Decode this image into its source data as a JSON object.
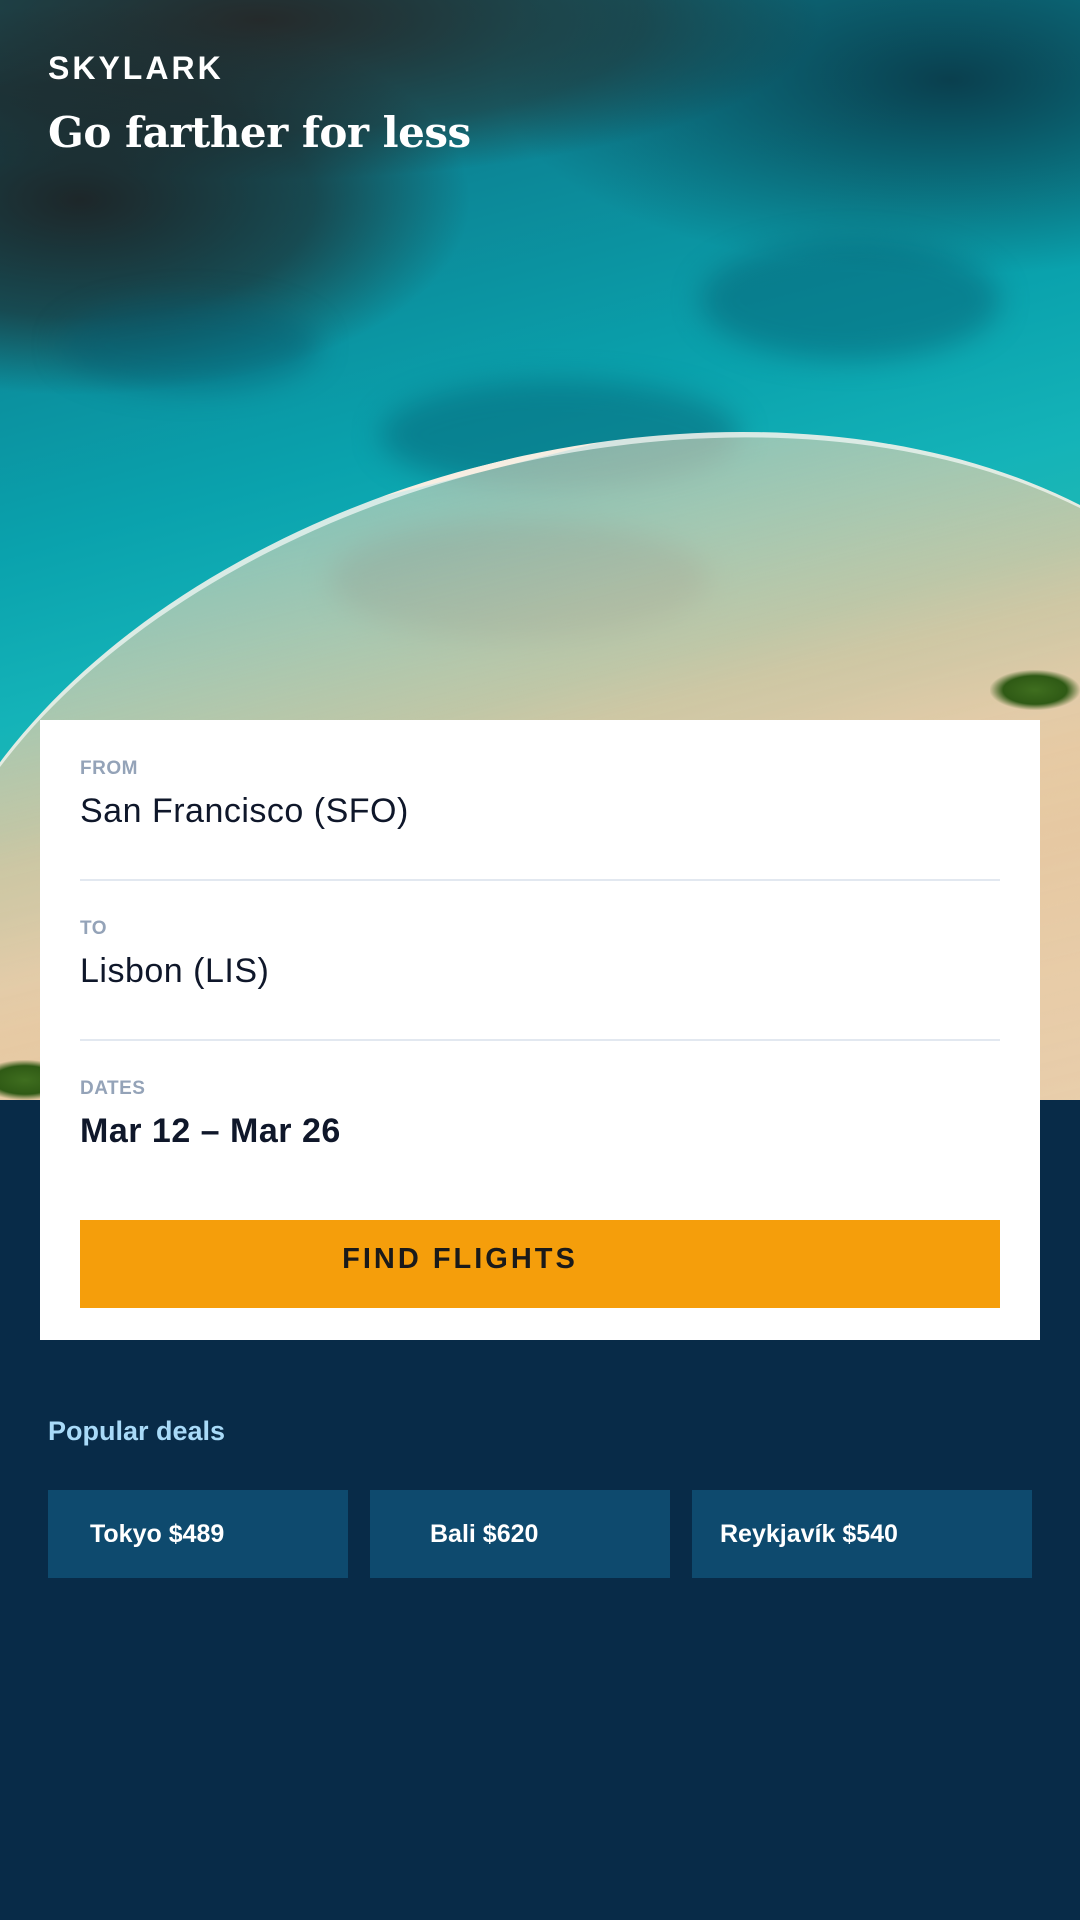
{
  "brand": {
    "name": "SKYLARK",
    "tagline": "Go farther for less"
  },
  "search": {
    "from": {
      "label": "FROM",
      "value": "San Francisco (SFO)"
    },
    "to": {
      "label": "TO",
      "value": "Lisbon (LIS)"
    },
    "dates": {
      "label": "DATES",
      "value": "Mar 12 – Mar 26"
    },
    "submit_label": "FIND FLIGHTS"
  },
  "deals": {
    "title": "Popular deals",
    "items": [
      {
        "label": "Tokyo $489"
      },
      {
        "label": "Bali $620"
      },
      {
        "label": "Reykjavík $540"
      }
    ]
  },
  "colors": {
    "background": "#082b48",
    "card": "#ffffff",
    "accent": "#f59e0b",
    "deal_card": "#0e4a6e",
    "deals_title": "#a8daf8",
    "field_label": "#94a3b8",
    "field_value": "#0f172a"
  }
}
